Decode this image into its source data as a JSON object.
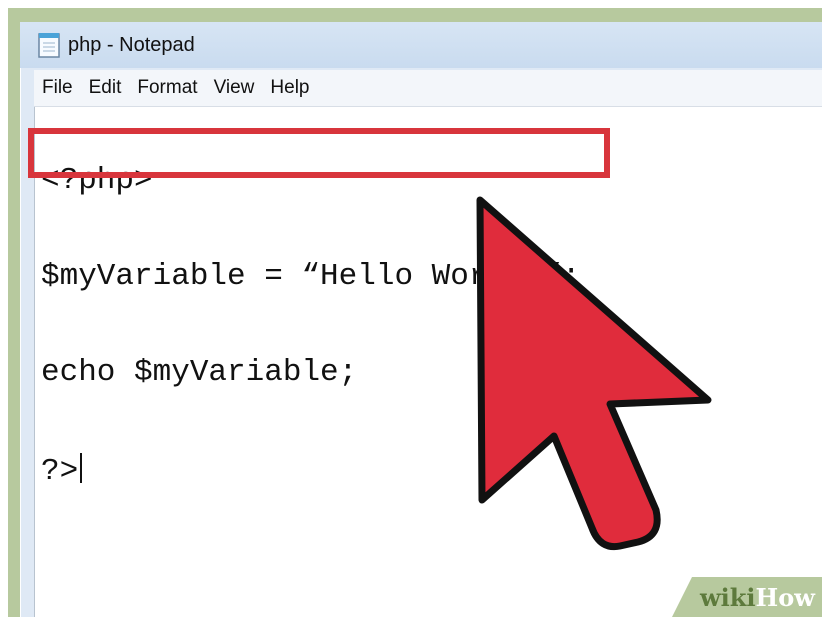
{
  "window": {
    "title": "php - Notepad"
  },
  "menu": {
    "items": [
      "File",
      "Edit",
      "Format",
      "View",
      "Help"
    ]
  },
  "editor": {
    "lines": [
      "<?php>",
      "$myVariable = “Hello World!”;",
      "echo $myVariable;",
      "?>"
    ]
  },
  "annotation": {
    "highlight_color": "#d8353c",
    "arrow_color": "#e02c3c"
  },
  "watermark": {
    "wiki": "wiki",
    "how": "How"
  }
}
